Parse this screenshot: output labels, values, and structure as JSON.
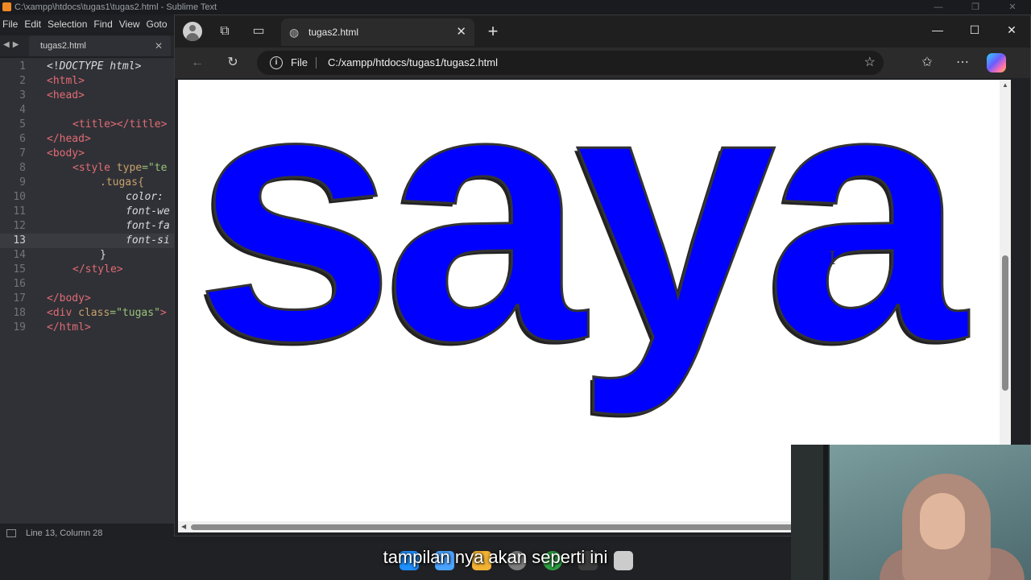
{
  "sublime": {
    "title": "C:\\xampp\\htdocs\\tugas1\\tugas2.html - Sublime Text",
    "menu": [
      "File",
      "Edit",
      "Selection",
      "Find",
      "View",
      "Goto"
    ],
    "tab_label": "tugas2.html",
    "active_line": 13,
    "status": "Line 13, Column 28",
    "lines": [
      {
        "n": "1"
      },
      {
        "n": "2"
      },
      {
        "n": "3"
      },
      {
        "n": "4"
      },
      {
        "n": "5"
      },
      {
        "n": "6"
      },
      {
        "n": "7"
      },
      {
        "n": "8"
      },
      {
        "n": "9"
      },
      {
        "n": "10"
      },
      {
        "n": "11"
      },
      {
        "n": "12"
      },
      {
        "n": "13"
      },
      {
        "n": "14"
      },
      {
        "n": "15"
      },
      {
        "n": "16"
      },
      {
        "n": "17"
      },
      {
        "n": "18"
      },
      {
        "n": "19"
      }
    ],
    "code": {
      "l1_a": "<!",
      "l1_b": "DOCTYPE",
      "l1_c": "html",
      "l1_d": ">",
      "l2": "<html>",
      "l3": "<head>",
      "l5_a": "<title>",
      "l5_b": "</title>",
      "l6": "</head>",
      "l7": "<body>",
      "l8_a": "<style",
      "l8_b": "type",
      "l8_c": "=\"te",
      "l9": ".tugas{",
      "l10_a": "color:",
      "l10_b": " ",
      "l11": "font-we",
      "l12": "font-fa",
      "l13": "font-si",
      "l14": "}",
      "l15": "</style>",
      "l17": "</body>",
      "l18_a": "<div",
      "l18_b": "class",
      "l18_c": "=\"tugas\"",
      "l18_d": ">",
      "l19": "</html>"
    }
  },
  "browser": {
    "tab_title": "tugas2.html",
    "address_scheme": "File",
    "address_url": "C:/xampp/htdocs/tugas1/tugas2.html",
    "page_text": "saya",
    "text_color": "#0000ff",
    "vertical_scroll_fraction": 0.45
  },
  "subtitle": "tampilan nya akan seperti ini",
  "icons": [
    "sublime-logo-icon",
    "profile-icon",
    "workspaces-icon",
    "tab-actions-icon",
    "globe-icon",
    "close-icon",
    "new-tab-icon",
    "minimize-icon",
    "maximize-icon",
    "back-icon",
    "refresh-icon",
    "info-icon",
    "favorite-star-icon",
    "favorites-icon",
    "more-icon",
    "copilot-icon",
    "text-cursor-icon"
  ],
  "colors": {
    "taskbar_icons": [
      "#1e90ff",
      "#4aa3ff",
      "#f2b233",
      "#7d7d7d",
      "#2ea043",
      "#3c3c3c",
      "#cccccc"
    ]
  }
}
